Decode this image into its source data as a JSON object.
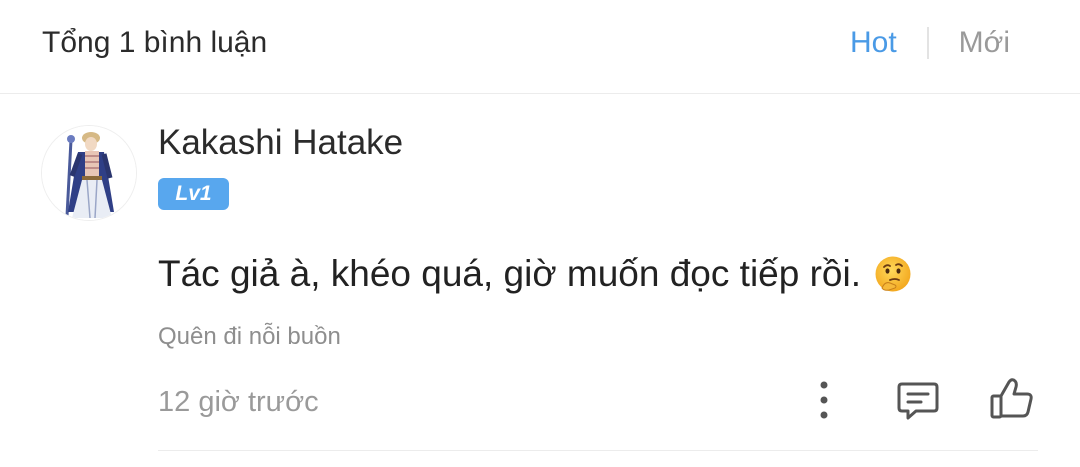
{
  "header": {
    "title": "Tổng 1 bình luận",
    "sort_tabs": [
      {
        "label": "Hot",
        "active": true
      },
      {
        "label": "Mới",
        "active": false
      }
    ]
  },
  "comment": {
    "username": "Kakashi Hatake",
    "level": "Lv1",
    "text": "Tác giả à, khéo quá, giờ muốn đọc tiếp rồi.",
    "emoji": "thinking-face",
    "signature": "Quên đi nỗi buồn",
    "time": "12 giờ trước",
    "actions": {
      "more_icon": "more-vertical-icon",
      "reply_icon": "comment-icon",
      "like_icon": "thumbs-up-icon"
    }
  },
  "colors": {
    "accent": "#4a9ae6",
    "badge": "#58a7ee",
    "muted_text": "#9a9a9a",
    "divider": "#ececec"
  }
}
